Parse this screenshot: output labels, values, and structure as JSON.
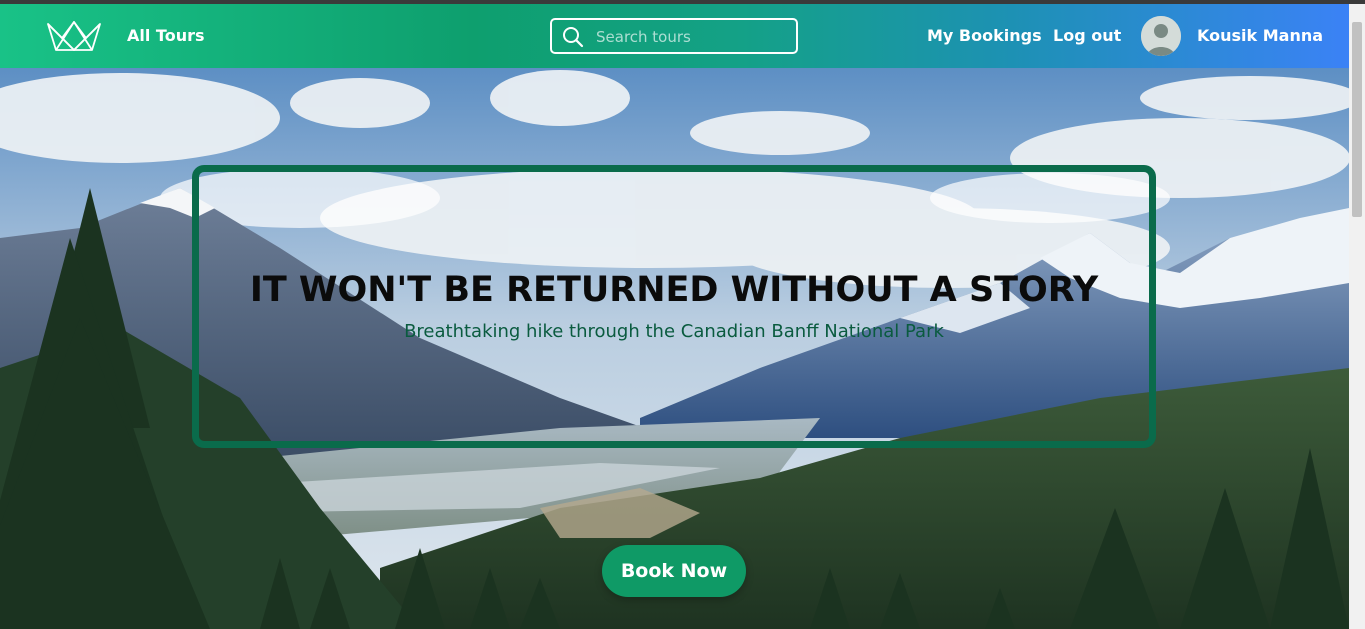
{
  "colors": {
    "nav_gradient_start": "#19c287",
    "nav_gradient_end": "#3b82f6",
    "frame_border": "#0a6b4b",
    "button_bg": "#0f9a66",
    "subtitle": "#0a5b3f"
  },
  "navbar": {
    "logo_icon": "crown-logo-icon",
    "all_tours_label": "All Tours",
    "search": {
      "placeholder": "Search tours",
      "value": "",
      "icon": "search-icon"
    },
    "my_bookings_label": "My Bookings",
    "logout_label": "Log out",
    "user": {
      "name": "Kousik Manna",
      "avatar_icon": "user-avatar-icon"
    }
  },
  "hero": {
    "title": "IT WON'T BE RETURNED WITHOUT A STORY",
    "subtitle": "Breathtaking hike through the Canadian Banff National Park",
    "cta_label": "Book Now"
  }
}
